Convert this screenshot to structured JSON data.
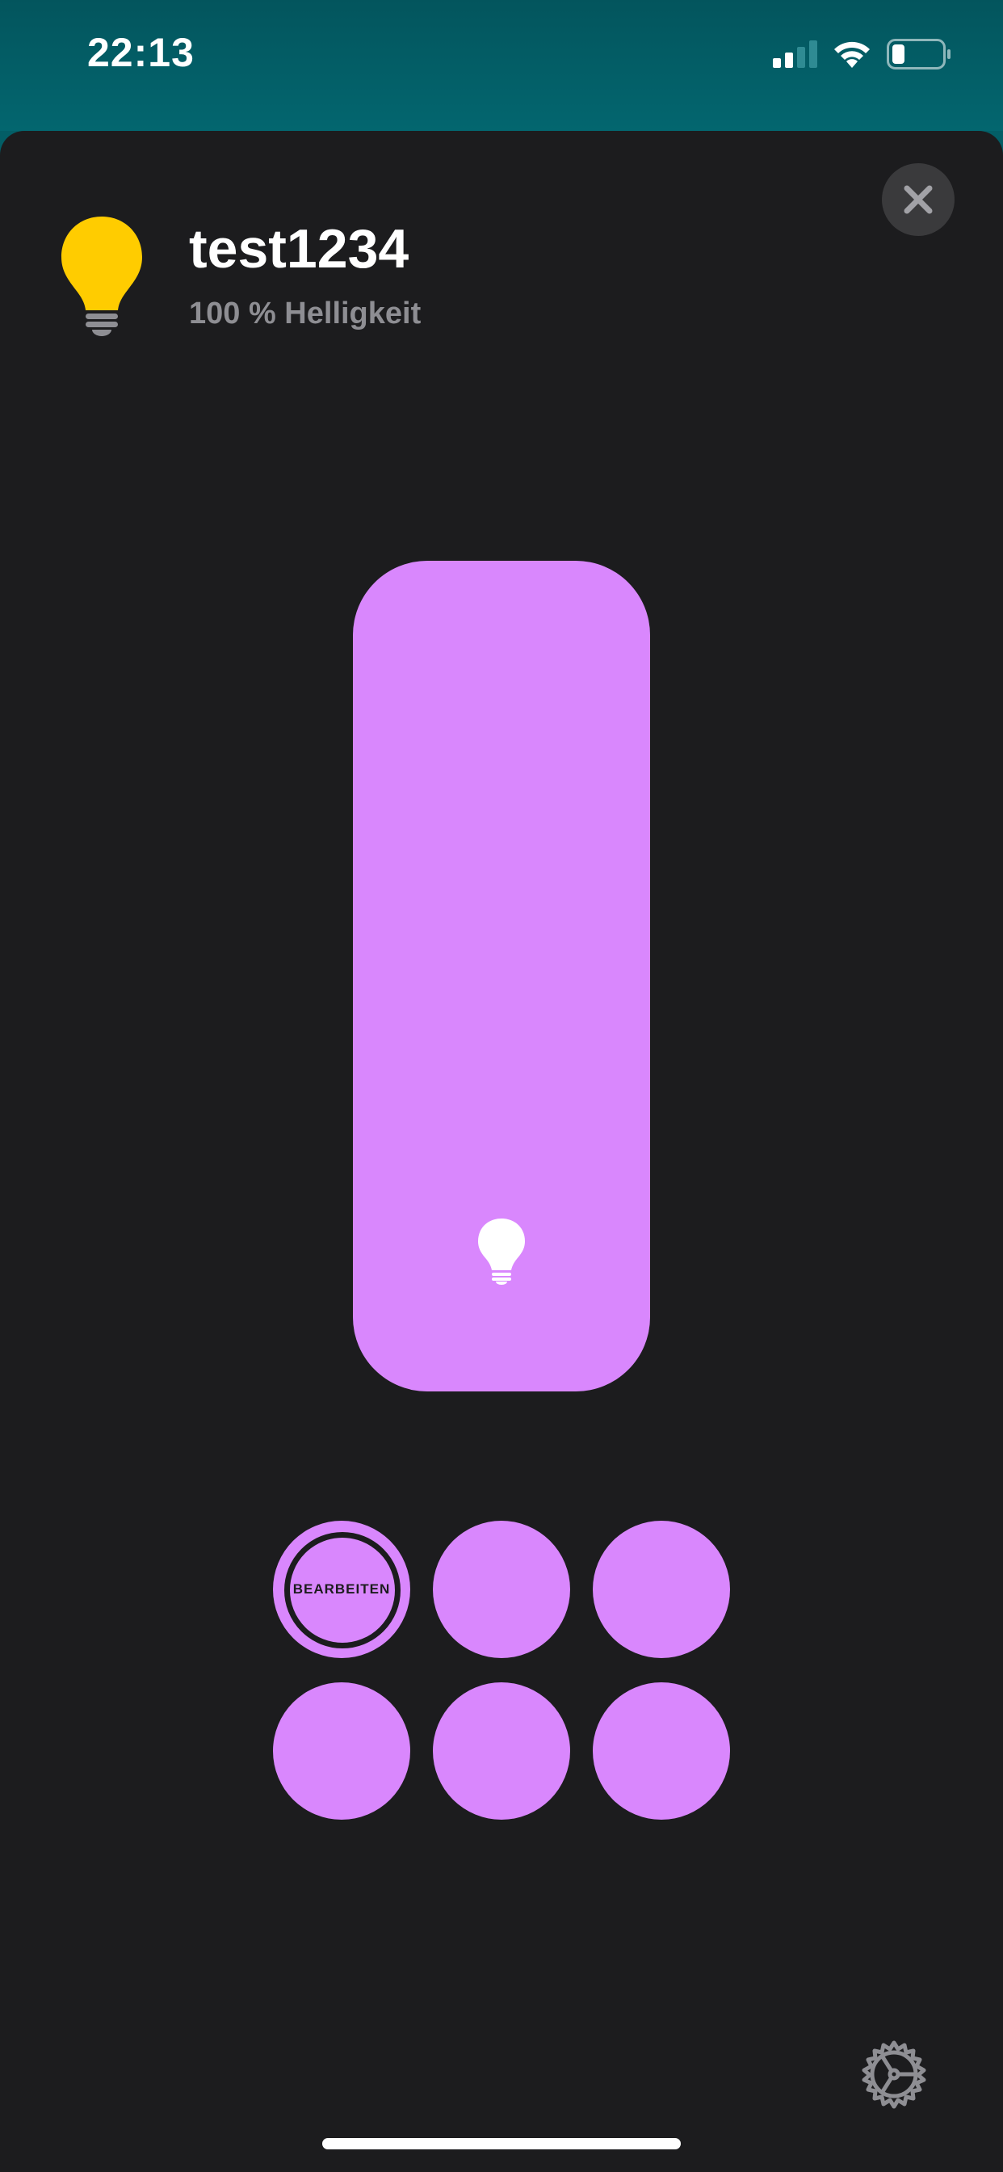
{
  "status_bar": {
    "time": "22:13",
    "signal_icon": "cellular-signal-icon",
    "wifi_icon": "wifi-icon",
    "battery_icon": "battery-icon",
    "battery_level": 0.25
  },
  "header": {
    "name": "test1234",
    "status": "100 % Helligkeit",
    "icon": "lightbulb-icon",
    "icon_color": "#ffcc00",
    "close_icon": "close-icon"
  },
  "slider": {
    "brightness": 1.0,
    "fill_color": "#d987fd",
    "track_color": "#3a3a3c",
    "icon": "lightbulb-icon"
  },
  "presets": {
    "edit_label": "BEARBEITEN",
    "color": "#d987fd",
    "items": [
      {
        "selected": true
      },
      {
        "selected": false
      },
      {
        "selected": false
      },
      {
        "selected": false
      },
      {
        "selected": false
      },
      {
        "selected": false
      }
    ]
  },
  "footer": {
    "settings_icon": "gear-icon"
  },
  "colors": {
    "background": "#1c1c1e",
    "status_bar": "#035e66",
    "accent": "#d987fd",
    "secondary_text": "#8e8e93"
  }
}
